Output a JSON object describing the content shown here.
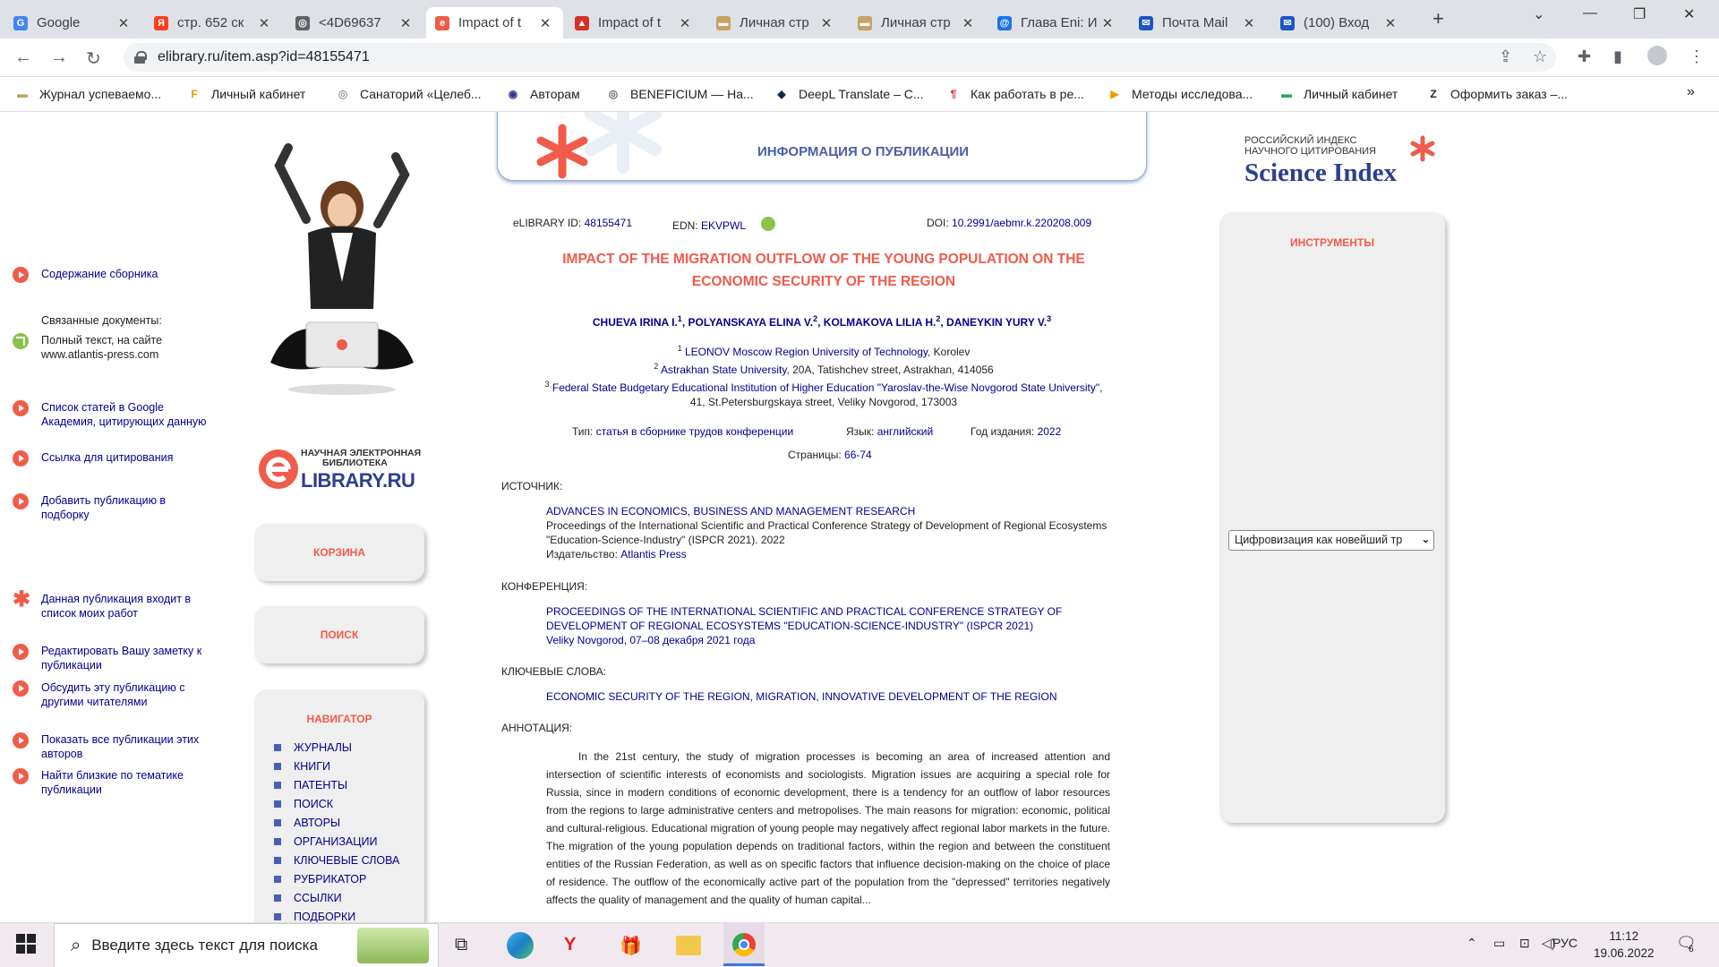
{
  "browser": {
    "tabs": [
      {
        "title": "Google",
        "icon": "google-icon",
        "color": "#4285f4",
        "glyph": "G"
      },
      {
        "title": "стр. 652 ск",
        "icon": "yandex-icon",
        "color": "#fc3f1d",
        "glyph": "Я"
      },
      {
        "title": "<4D69637",
        "icon": "globe-icon",
        "color": "#5f6368",
        "glyph": "◎"
      },
      {
        "title": "Impact of t",
        "icon": "elibrary-icon",
        "color": "#f05b4a",
        "glyph": "e",
        "active": true
      },
      {
        "title": "Impact of t",
        "icon": "pdf-icon",
        "color": "#d93025",
        "glyph": "▲"
      },
      {
        "title": "Личная стр",
        "icon": "building-icon",
        "color": "#c8a165",
        "glyph": "▬"
      },
      {
        "title": "Личная стр",
        "icon": "building-icon",
        "color": "#c8a165",
        "glyph": "▬"
      },
      {
        "title": "Глава Eni: И",
        "icon": "at-icon",
        "color": "#1a73e8",
        "glyph": "@"
      },
      {
        "title": "Почта Mail",
        "icon": "mail-icon",
        "color": "#1a56c4",
        "glyph": "✉"
      },
      {
        "title": "(100) Вход",
        "icon": "mail-icon",
        "color": "#1a56c4",
        "glyph": "✉"
      }
    ],
    "url": "elibrary.ru/item.asp?id=48155471",
    "bookmarks": [
      {
        "label": "Журнал успеваемо...",
        "icon": "journal-icon",
        "color": "#c8a165",
        "glyph": "▬"
      },
      {
        "label": "Личный кабинет",
        "icon": "f-icon",
        "color": "#f29900",
        "glyph": "F"
      },
      {
        "label": "Санаторий «Целеб...",
        "icon": "sanatorium-icon",
        "color": "#999999",
        "glyph": "◎"
      },
      {
        "label": "Авторам",
        "icon": "globe-icon",
        "color": "#2d3a8c",
        "glyph": "◉"
      },
      {
        "label": "BENEFICIUM — На...",
        "icon": "beneficium-icon",
        "color": "#666666",
        "glyph": "◎"
      },
      {
        "label": "DeepL Translate – C...",
        "icon": "deepl-icon",
        "color": "#0f2b46",
        "glyph": "◆"
      },
      {
        "label": "Как работать в ре...",
        "icon": "paragraph-icon",
        "color": "#d93025",
        "glyph": "¶"
      },
      {
        "label": "Методы исследова...",
        "icon": "video-icon",
        "color": "#f29900",
        "glyph": "▶"
      },
      {
        "label": "Личный кабинет",
        "icon": "cabinet-icon",
        "color": "#34a853",
        "glyph": "▬"
      },
      {
        "label": "Оформить заказ –...",
        "icon": "zara-icon",
        "color": "#222222",
        "glyph": "Z"
      }
    ]
  },
  "left": {
    "logo_small": "НАУЧНАЯ ЭЛЕКТРОННАЯ",
    "logo_small2": "БИБЛИОТЕКА",
    "logo_big": "LIBRARY.RU",
    "cart": "КОРЗИНА",
    "search": "ПОИСК",
    "navigator": "НАВИГАТОР",
    "nav_items": [
      "ЖУРНАЛЫ",
      "КНИГИ",
      "ПАТЕНТЫ",
      "ПОИСК",
      "АВТОРЫ",
      "ОРГАНИЗАЦИИ",
      "КЛЮЧЕВЫЕ СЛОВА",
      "РУБРИКАТОР",
      "ССЫЛКИ",
      "ПОДБОРКИ"
    ]
  },
  "header": {
    "title": "ИНФОРМАЦИЯ О ПУБЛИКАЦИИ"
  },
  "science_index": {
    "line1": "РОССИЙСКИЙ ИНДЕКС",
    "line2": "НАУЧНОГО ЦИТИРОВАНИЯ",
    "brand": "Science Index"
  },
  "pub": {
    "elib_label": "eLIBRARY ID:",
    "elib_id": "48155471",
    "edn_label": "EDN:",
    "edn": "EKVPWL",
    "doi_label": "DOI:",
    "doi": "10.2991/aebmr.k.220208.009",
    "title": "IMPACT OF THE MIGRATION OUTFLOW OF THE YOUNG POPULATION ON THE ECONOMIC SECURITY OF THE REGION",
    "authors": [
      {
        "name": "CHUEVA IRINA I.",
        "sup": "1"
      },
      {
        "name": "POLYANSKAYA ELINA V.",
        "sup": "2"
      },
      {
        "name": "KOLMAKOVA LILIA H.",
        "sup": "2"
      },
      {
        "name": "DANEYKIN YURY V.",
        "sup": "3"
      }
    ],
    "affiliations": [
      {
        "sup": "1",
        "org": "LEONOV Moscow Region University of Technology",
        "addr": ", Korolev"
      },
      {
        "sup": "2",
        "org": "Astrakhan State University",
        "addr": ", 20A, Tatishchev street, Astrakhan, 414056"
      },
      {
        "sup": "3",
        "org": "Federal State Budgetary Educational Institution of Higher Education \"Yaroslav-the-Wise Novgorod State University\"",
        "addr": ", 41, St.Petersburgskaya street, Veliky Novgorod, 173003"
      }
    ],
    "type_label": "Тип:",
    "type": "статья в сборнике трудов конференции",
    "lang_label": "Язык:",
    "lang": "английский",
    "year_label": "Год издания:",
    "year": "2022",
    "pages_label": "Страницы:",
    "pages": "66-74",
    "source_label": "ИСТОЧНИК:",
    "source_title": "ADVANCES IN ECONOMICS, BUSINESS AND MANAGEMENT RESEARCH",
    "source_desc": "Proceedings of the International Scientific and Practical Conference Strategy of Development of Regional Ecosystems \"Education-Science-Industry\" (ISPCR 2021). 2022",
    "publisher_label": "Издательство:",
    "publisher": "Atlantis Press",
    "conf_label": "КОНФЕРЕНЦИЯ:",
    "conf_title": "PROCEEDINGS OF THE INTERNATIONAL SCIENTIFIC AND PRACTICAL CONFERENCE STRATEGY OF DEVELOPMENT OF REGIONAL ECOSYSTEMS \"EDUCATION-SCIENCE-INDUSTRY\" (ISPCR 2021)",
    "conf_place": "Veliky Novgorod, 07–08 декабря 2021 года",
    "kw_label": "КЛЮЧЕВЫЕ СЛОВА:",
    "keywords": "ECONOMIC SECURITY OF THE REGION, MIGRATION, INNOVATIVE DEVELOPMENT OF THE REGION",
    "abs_label": "АННОТАЦИЯ:",
    "abstract": "In the 21st century, the study of migration processes is becoming an area of increased attention and intersection of scientific interests of economists and sociologists. Migration issues are acquiring a special role for Russia, since in modern conditions of economic development, there is a tendency for an outflow of labor resources from the regions to large administrative centers and metropolises. The main reasons for migration: economic, political and cultural-religious. Educational migration of young people may negatively affect regional labor markets in the future. The migration of the young population depends on traditional factors, within the region and between the constituent entities of the Russian Federation, as well as on specific factors that influence decision-making on the choice of place of residence. The outflow of the economically active part of the population from the \"depressed\" territories negatively affects the quality of management and the quality of human capital..."
  },
  "tools": {
    "title": "ИНСТРУМЕНТЫ",
    "contents": "Содержание сборника",
    "related": "Связанные документы:",
    "fulltext": "Полный текст, на сайте www.atlantis-press.com",
    "google": "Список статей в Google Академия, цитирующих данную",
    "cite": "Ссылка для цитирования",
    "add": "Добавить публикацию в подборку",
    "select_value": "Цифровизация как новейший тр",
    "in_list": "Данная публикация входит в список моих работ",
    "edit_note": "Редактировать Вашу заметку к публикации",
    "discuss": "Обсудить эту публикацию с другими читателями",
    "show_all": "Показать все публикации этих авторов",
    "similar": "Найти близкие по тематике публикации"
  },
  "taskbar": {
    "search": "Введите здесь текст для поиска",
    "lang": "РУС",
    "time": "11:12",
    "date": "19.06.2022",
    "notif": "6"
  }
}
